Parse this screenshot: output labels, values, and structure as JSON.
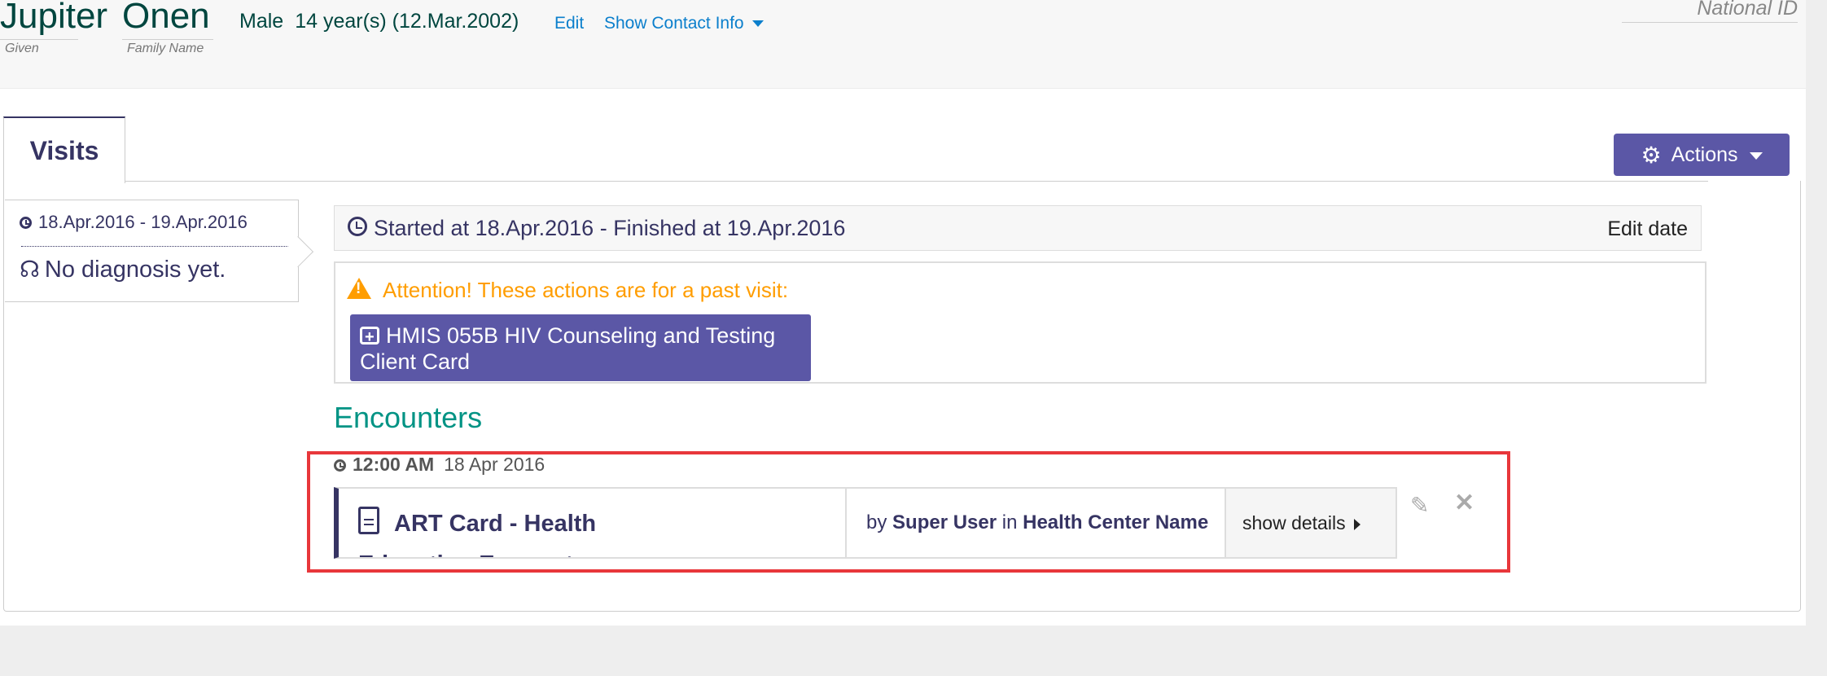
{
  "patient": {
    "given_name": "Jupiter",
    "family_name": "Onen",
    "given_label": "Given",
    "family_label": "Family Name",
    "gender": "Male",
    "age": "14 year(s) (12.Mar.2002)",
    "edit_link": "Edit",
    "contact_link": "Show Contact Info",
    "national_id_label": "National ID"
  },
  "tabs": {
    "visits": "Visits"
  },
  "actions": {
    "label": "Actions",
    "icon": "gear-icon"
  },
  "visit_list": {
    "dates": "18.Apr.2016 - 19.Apr.2016",
    "diagnosis": "No diagnosis yet."
  },
  "visit_detail": {
    "started_finished": "Started at 18.Apr.2016 - Finished at 19.Apr.2016",
    "edit_date": "Edit date",
    "attention": "Attention! These actions are for a past visit:",
    "form_button": "HMIS 055B HIV Counseling and Testing Client Card"
  },
  "encounters": {
    "heading": "Encounters",
    "time": "12:00 AM",
    "date": "18 Apr 2016",
    "title": "ART Card - Health Education Encounter",
    "by_prefix": "by",
    "user": "Super User",
    "in_word": "in",
    "location": "Health Center Name",
    "show_details": "show details"
  },
  "colors": {
    "primary": "#5b57a6",
    "heading_green": "#009384",
    "link_blue": "#0b7fcc",
    "warning": "#ff9d00",
    "highlight_red": "#e8373b"
  }
}
